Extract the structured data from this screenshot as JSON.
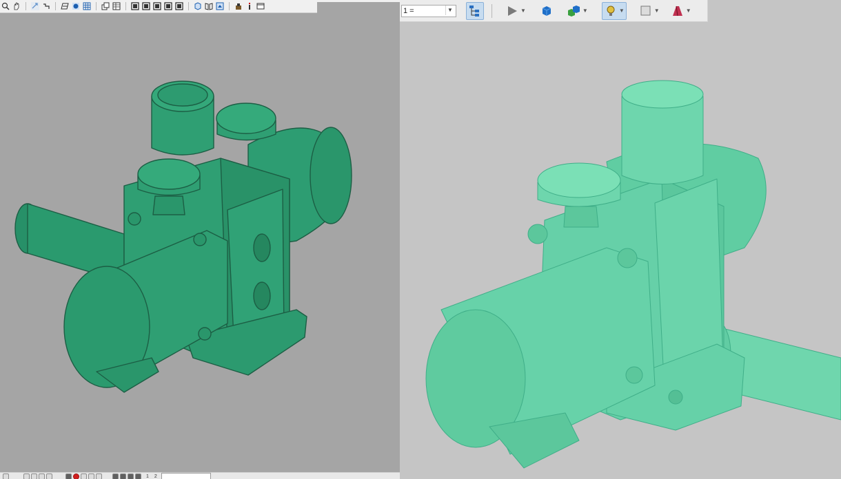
{
  "left_window": {
    "toolbar": {
      "groups": [
        [
          "zoom-icon",
          "pan-hand-icon"
        ],
        [
          "rotate-icon",
          "rotate-free-icon"
        ],
        [
          "wireframe-icon",
          "shaded-icon",
          "grid-icon"
        ],
        [
          "new-view-icon",
          "table-icon"
        ],
        [
          "view-front-icon",
          "view-back-icon",
          "view-left-icon",
          "view-right-icon",
          "view-top-icon"
        ],
        [
          "view-iso-icon",
          "view-mirror-icon",
          "view-fit-icon"
        ],
        [
          "measure-icon",
          "info-icon",
          "window-icon"
        ]
      ]
    },
    "viewport": {
      "background": "#a5a5a5",
      "model_color": "#2f9d73"
    },
    "bottom_bar": {
      "text_a": "1",
      "text_b": "2"
    }
  },
  "right_window": {
    "toolbar": {
      "layer_combo_value": "1 =",
      "buttons": [
        {
          "name": "model-tree-icon",
          "pressed": true
        },
        {
          "name": "play-icon",
          "dropdown": true
        },
        {
          "name": "solid-cube-icon"
        },
        {
          "name": "cube-group-icon",
          "dropdown": true
        },
        {
          "name": "lighting-bulb-icon",
          "pressed": true,
          "dropdown": true
        },
        {
          "name": "display-style-icon",
          "dropdown": true
        },
        {
          "name": "material-icon",
          "dropdown": true
        }
      ]
    },
    "viewport": {
      "background": "#c5c5c5",
      "model_color": "#66d2a8"
    }
  }
}
